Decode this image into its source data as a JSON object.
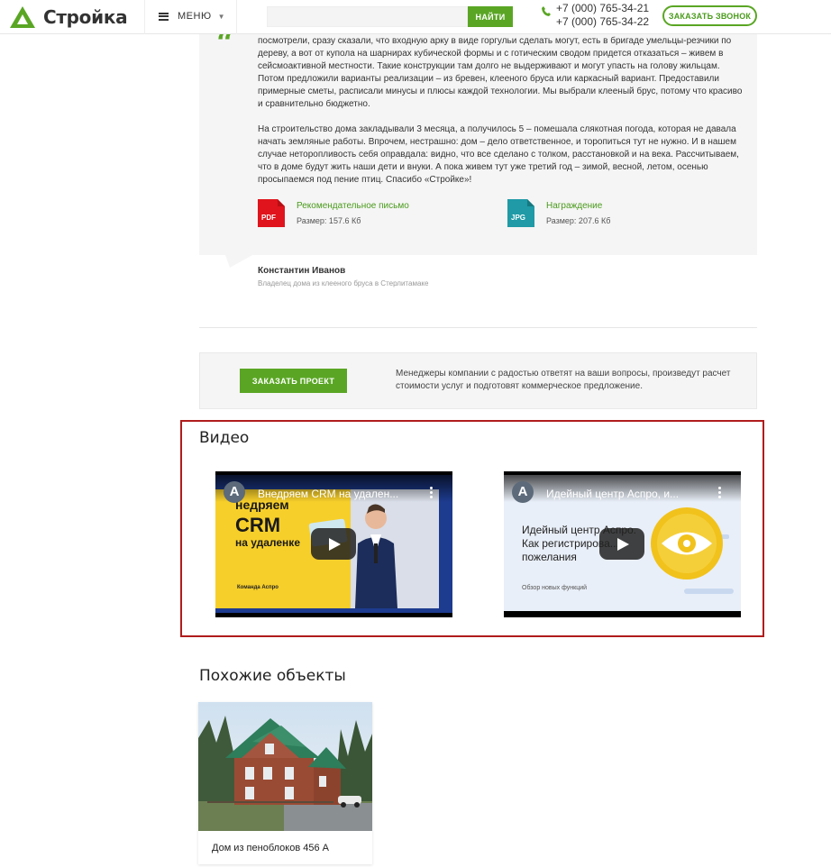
{
  "header": {
    "logo_text": "Стройка",
    "menu_label": "МЕНЮ",
    "search_placeholder": "",
    "search_button": "НАЙТИ",
    "phones": [
      "+7 (000) 765-34-21",
      "+7 (000) 765-34-22"
    ],
    "callback_button": "ЗАКАЗАТЬ ЗВОНОК",
    "accent_color": "#5aa624"
  },
  "review": {
    "paragraphs": [
      "посмотрели, сразу сказали, что входную арку в виде горгульи сделать могут, есть в бригаде умельцы-резчики по дереву, а вот от купола на шарнирах кубической формы и с готическим сводом придется отказаться – живем в сейсмоактивной местности. Такие конструкции там долго не выдерживают и могут упасть на голову жильцам. Потом предложили варианты реализации – из бревен, клееного бруса или каркасный вариант. Предоставили примерные сметы, расписали минусы и плюсы каждой технологии. Мы выбрали клееный брус, потому что красиво и сравнительно бюджетно.",
      "На строительство дома закладывали 3 месяца, а получилось 5 – помешала слякотная погода, которая не давала начать земляные работы. Впрочем, нестрашно: дом – дело ответственное, и торопиться тут не нужно. И в нашем случае неторопливость себя оправдала: видно, что все сделано с толком, расстановкой и на века. Рассчитываем, что в доме будут жить наши дети и внуки. А пока живем тут уже третий год – зимой, весной, летом, осенью просыпаемся под пение птиц. Спасибо «Стройке»!"
    ],
    "files": [
      {
        "type": "PDF",
        "name": "Рекомендательное письмо",
        "size": "Размер: 157.6 Кб",
        "color": "#e0141c"
      },
      {
        "type": "JPG",
        "name": "Награждение",
        "size": "Размер: 207.6 Кб",
        "color": "#1f9aa6"
      }
    ],
    "author": "Константин Иванов",
    "author_role": "Владелец дома из клееного бруса в Стерлитамаке"
  },
  "order": {
    "button": "ЗАКАЗАТЬ ПРОЕКТ",
    "text": "Менеджеры компании с радостью ответят на ваши вопросы, произведут расчет стоимости услуг и подготовят коммерческое предложение."
  },
  "video_section": {
    "title": "Видео",
    "videos": [
      {
        "title": "Внедряем CRM на удален...",
        "channel_initial": "А",
        "thumb_lines": [
          "недряем",
          "CRM",
          "на удаленке"
        ],
        "thumb_caption": "Команда Аспро"
      },
      {
        "title": "Идейный центр Аспро, и...",
        "channel_initial": "А",
        "thumb_lines": [
          "Идейный центр Аспро.",
          "Как регистрирова...",
          "пожелания"
        ],
        "thumb_caption": "Обзор новых функций"
      }
    ]
  },
  "similar": {
    "title": "Похожие объекты",
    "items": [
      {
        "name": "Дом из пеноблоков 456 А"
      }
    ]
  }
}
